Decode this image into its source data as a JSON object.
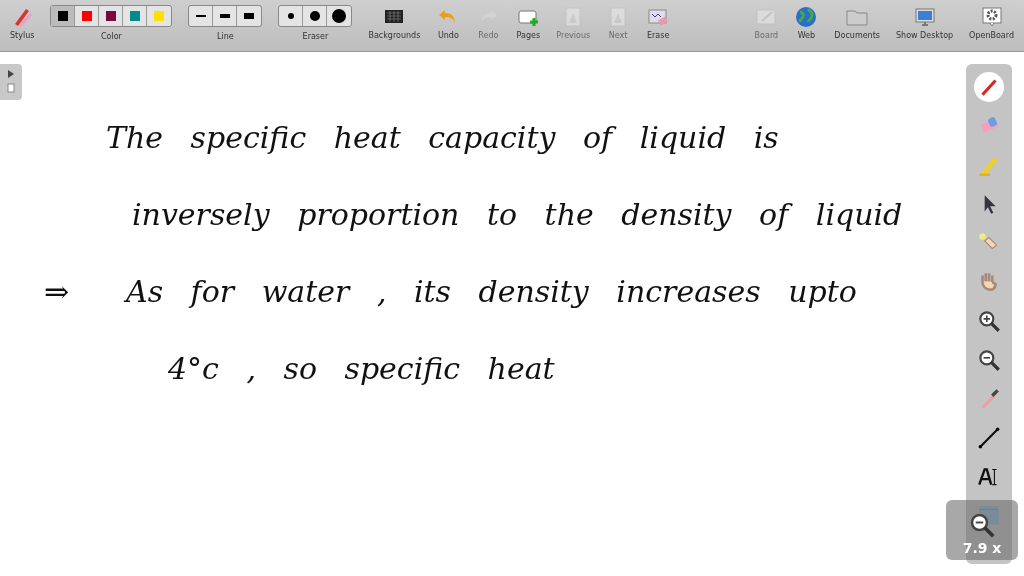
{
  "toolbar": {
    "groups": [
      {
        "kind": "tool",
        "label": "Stylus",
        "disabled": false
      },
      {
        "kind": "swatches",
        "label": "Color",
        "items": [
          {
            "color": "#000000",
            "selected": true
          },
          {
            "color": "#ff0000",
            "selected": false
          },
          {
            "color": "#7a0a3c",
            "selected": false
          },
          {
            "color": "#008b8b",
            "selected": false
          },
          {
            "color": "#ffe000",
            "selected": false
          }
        ]
      },
      {
        "kind": "lines",
        "label": "Line"
      },
      {
        "kind": "dots",
        "label": "Eraser"
      },
      {
        "kind": "tool",
        "label": "Backgrounds",
        "disabled": false
      },
      {
        "kind": "tool",
        "label": "Undo",
        "disabled": false
      },
      {
        "kind": "tool",
        "label": "Redo",
        "disabled": true
      },
      {
        "kind": "tool",
        "label": "Pages",
        "disabled": false
      },
      {
        "kind": "tool",
        "label": "Previous",
        "disabled": true
      },
      {
        "kind": "tool",
        "label": "Next",
        "disabled": true
      },
      {
        "kind": "tool",
        "label": "Erase",
        "disabled": false
      },
      {
        "kind": "spacer"
      },
      {
        "kind": "tool",
        "label": "Board",
        "disabled": true
      },
      {
        "kind": "tool",
        "label": "Web",
        "disabled": false
      },
      {
        "kind": "tool",
        "label": "Documents",
        "disabled": false
      },
      {
        "kind": "tool",
        "label": "Show Desktop",
        "disabled": false
      },
      {
        "kind": "tool",
        "label": "OpenBoard",
        "disabled": false
      }
    ]
  },
  "board": {
    "lines": [
      {
        "text": "The specific heat capacity of liquid is"
      },
      {
        "text": "inversely proportion to the density of liquid"
      },
      {
        "arrow": "⇒",
        "text": "As for water , its density increases upto"
      },
      {
        "text": "4°c , so specific heat"
      }
    ]
  },
  "dock": {
    "tools": [
      {
        "selected": true
      },
      {
        "selected": false
      },
      {
        "selected": false
      },
      {
        "selected": false
      },
      {
        "selected": false
      },
      {
        "selected": false
      },
      {
        "selected": false
      },
      {
        "selected": false
      },
      {
        "selected": false
      },
      {
        "selected": false
      },
      {
        "selected": false
      },
      {
        "selected": false
      }
    ]
  },
  "zoom_badge": {
    "value": "7.9 x"
  }
}
